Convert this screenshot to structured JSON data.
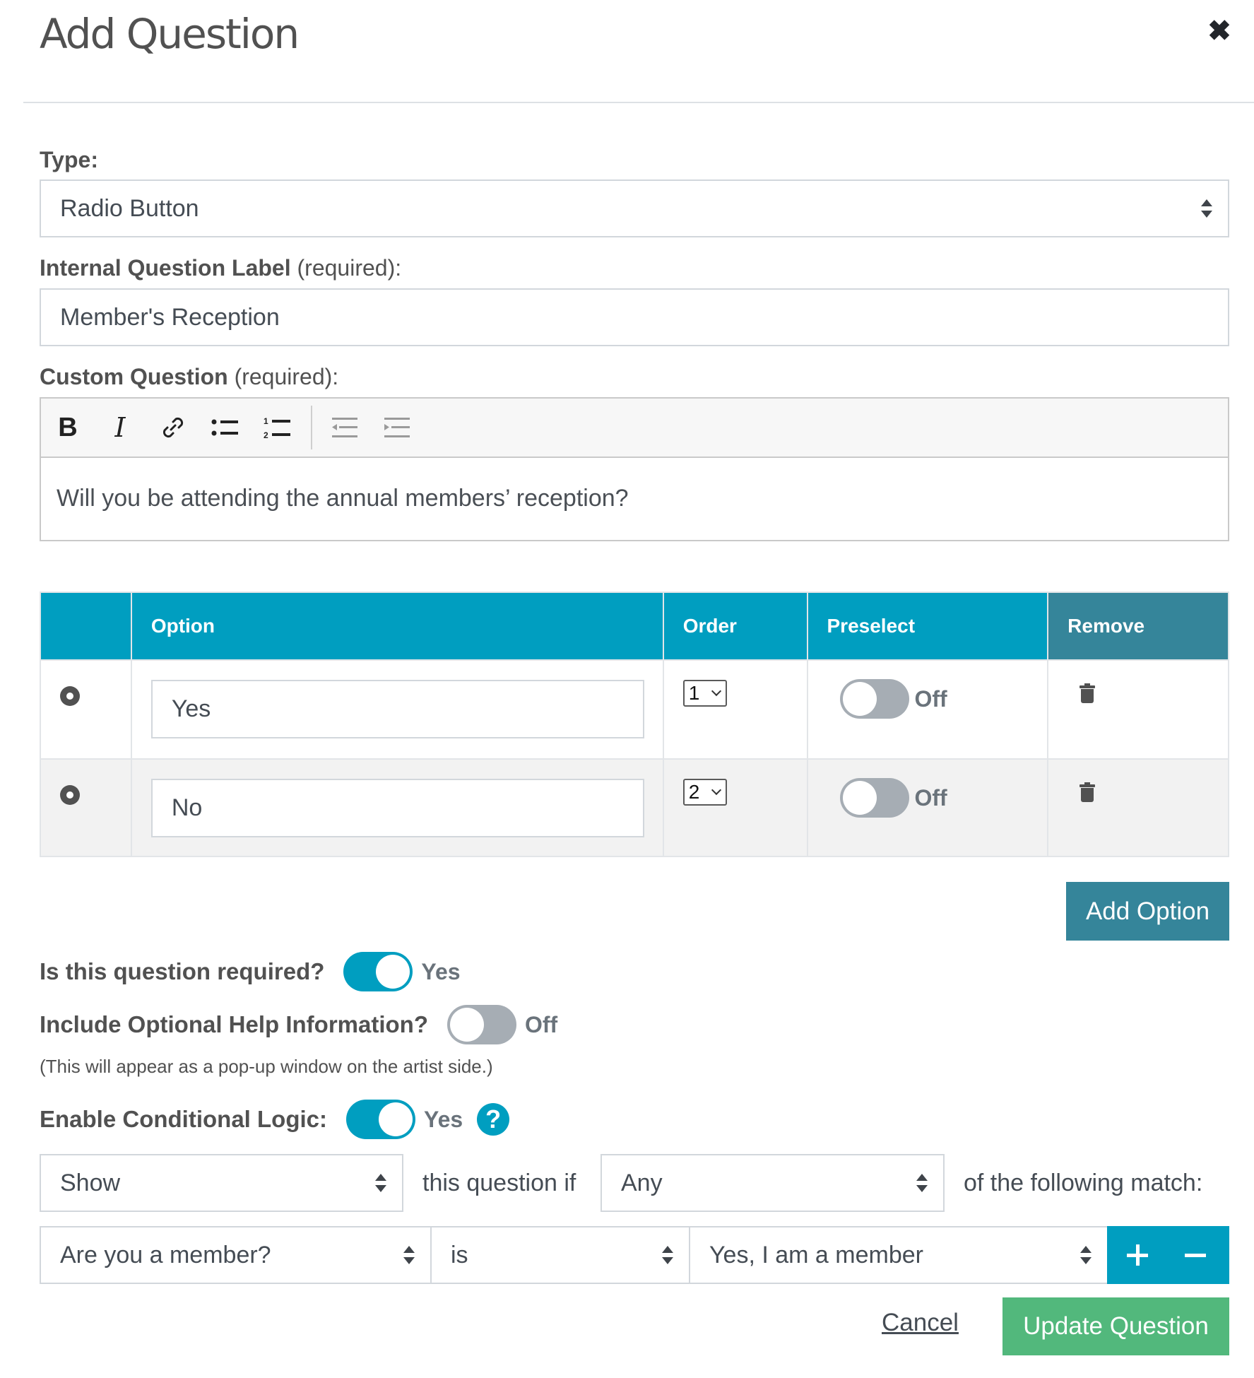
{
  "dialog": {
    "title": "Add Question",
    "close_icon": "close-x-icon"
  },
  "type_field": {
    "label": "Type:",
    "value": "Radio Button"
  },
  "internal_label_field": {
    "label_bold": "Internal Question Label",
    "label_suffix": " (required):",
    "value": "Member's Reception"
  },
  "custom_question_field": {
    "label_bold": "Custom Question",
    "label_suffix": " (required):",
    "toolbar": [
      "bold-icon",
      "italic-icon",
      "link-icon",
      "bullet-list-icon",
      "numbered-list-icon",
      "outdent-icon",
      "indent-icon"
    ],
    "value": "Will you be attending the annual members’ reception?"
  },
  "options_table": {
    "headers": [
      "",
      "Option",
      "Order",
      "Preselect",
      "Remove"
    ],
    "rows": [
      {
        "option": "Yes",
        "order": "1",
        "preselect": false,
        "preselect_label": "Off"
      },
      {
        "option": "No",
        "order": "2",
        "preselect": false,
        "preselect_label": "Off"
      }
    ],
    "add_button": "Add Option"
  },
  "settings": {
    "required": {
      "label": "Is this question required?",
      "on": true,
      "state_label": "Yes"
    },
    "help_info": {
      "label": "Include Optional Help Information?",
      "on": false,
      "state_label": "Off",
      "note": "(This will appear as a pop-up window on the artist side.)"
    },
    "conditional": {
      "label": "Enable Conditional Logic:",
      "on": true,
      "state_label": "Yes",
      "help_glyph": "?"
    }
  },
  "logic": {
    "action": "Show",
    "connector": "this question if",
    "match_mode": "Any",
    "suffix": "of the following match:",
    "rule": {
      "question": "Are you a member?",
      "operator": "is",
      "value": "Yes, I am a member"
    }
  },
  "footer": {
    "cancel": "Cancel",
    "submit": "Update Question"
  },
  "colors": {
    "primary": "#009ec0",
    "secondary": "#35859a",
    "success": "#52b87c",
    "toggle_off": "#a6adb4"
  }
}
